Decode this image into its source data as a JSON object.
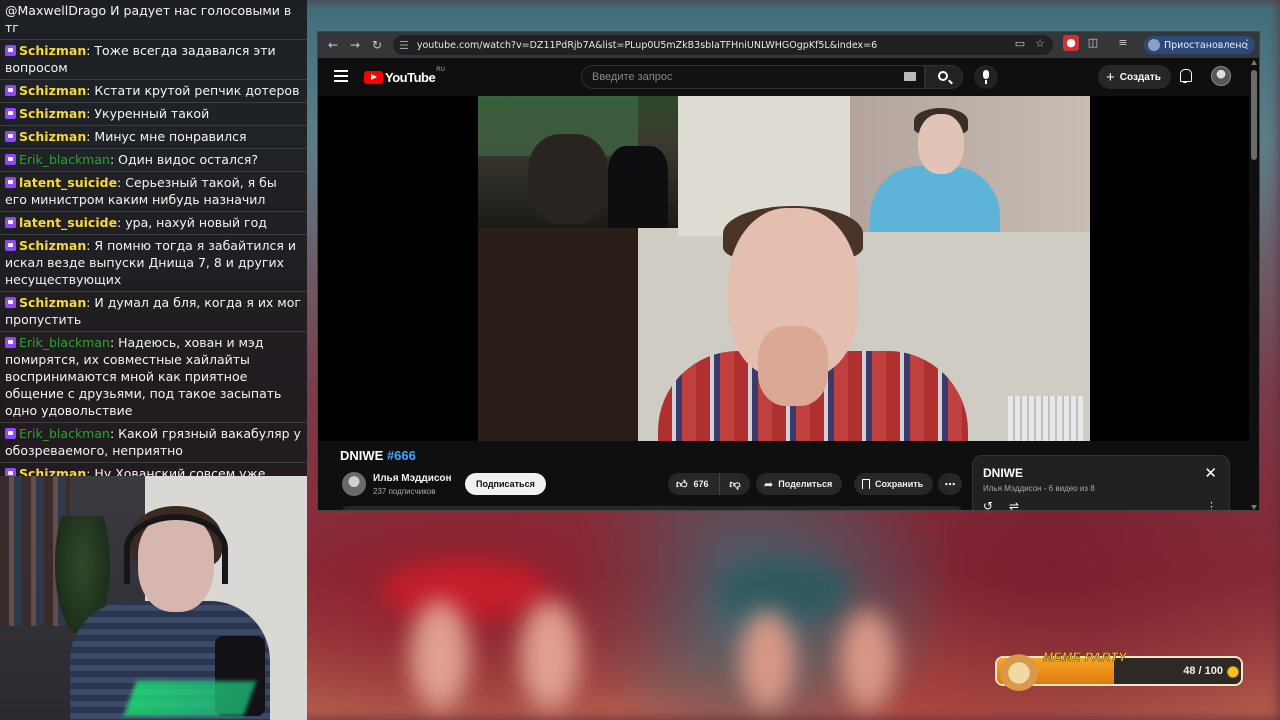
{
  "chat": {
    "messages": [
      {
        "nick": "",
        "nick_color": "",
        "text": "@MaxwellDrago И радует нас голосовыми в тг",
        "badge": false
      },
      {
        "nick": "Schizman",
        "nick_color": "yellow",
        "text": "Тоже всегда задавался эти вопросом",
        "badge": true
      },
      {
        "nick": "Schizman",
        "nick_color": "yellow",
        "text": "Кстати крутой репчик дотеров",
        "badge": true
      },
      {
        "nick": "Schizman",
        "nick_color": "yellow",
        "text": "Укуренный такой",
        "badge": true
      },
      {
        "nick": "Schizman",
        "nick_color": "yellow",
        "text": "Минус мне понравился",
        "badge": true
      },
      {
        "nick": "Erik_blackman",
        "nick_color": "green",
        "text": "Один видос остался?",
        "badge": true
      },
      {
        "nick": "latent_suicide",
        "nick_color": "yellow",
        "text": "Серьезный такой, я бы его министром каким нибудь назначил",
        "badge": true
      },
      {
        "nick": "latent_suicide",
        "nick_color": "yellow",
        "text": "ура, нахуй новый год",
        "badge": true
      },
      {
        "nick": "Schizman",
        "nick_color": "yellow",
        "text": "Я помню тогда я забайтился и искал везде выпуски Днища 7, 8 и других несуществующих",
        "badge": true
      },
      {
        "nick": "Schizman",
        "nick_color": "yellow",
        "text": "И думал да бля, когда я их мог пропустить",
        "badge": true
      },
      {
        "nick": "Erik_blackman",
        "nick_color": "green",
        "text": "Надеюсь, хован и мэд помирятся, их совместные хайлайты воспринимаются мной как приятное общение с друзьями, под такое засыпать одно удовольствие",
        "badge": true
      },
      {
        "nick": "Erik_blackman",
        "nick_color": "green",
        "text": "Какой грязный вакабуляр у обозреваемого, неприятно",
        "badge": true
      },
      {
        "nick": "Schizman",
        "nick_color": "yellow",
        "text": "Ну Хованский совсем уже спился и ёбнулся с этими проклятиями в веках всех подряд и с гойдой и пропалестинством",
        "badge": true
      }
    ]
  },
  "browser": {
    "url": "youtube.com/watch?v=DZ11PdRjb7A&list=PLup0U5mZkB3sbIaTFHniUNLWHGOgpKf5L&index=6",
    "profile_status": "Приостановлено"
  },
  "youtube": {
    "logo_text": "YouTube",
    "logo_region": "RU",
    "search_placeholder": "Введите запрос",
    "create_label": "Создать",
    "video_title_main": "DNIWE ",
    "video_title_tag": "#666",
    "channel_name": "Илья Мэддисон",
    "subscribers": "237 подписчиков",
    "subscribe_label": "Подписаться",
    "like_count": "676",
    "share_label": "Поделиться",
    "save_label": "Сохранить",
    "playlist": {
      "title": "DNIWE",
      "meta": "Илья Мэддисон - 6 видео из 8"
    }
  },
  "meme_party": {
    "logo": "MEME PARTY",
    "count_text": "48 / 100",
    "progress": 0.48
  }
}
